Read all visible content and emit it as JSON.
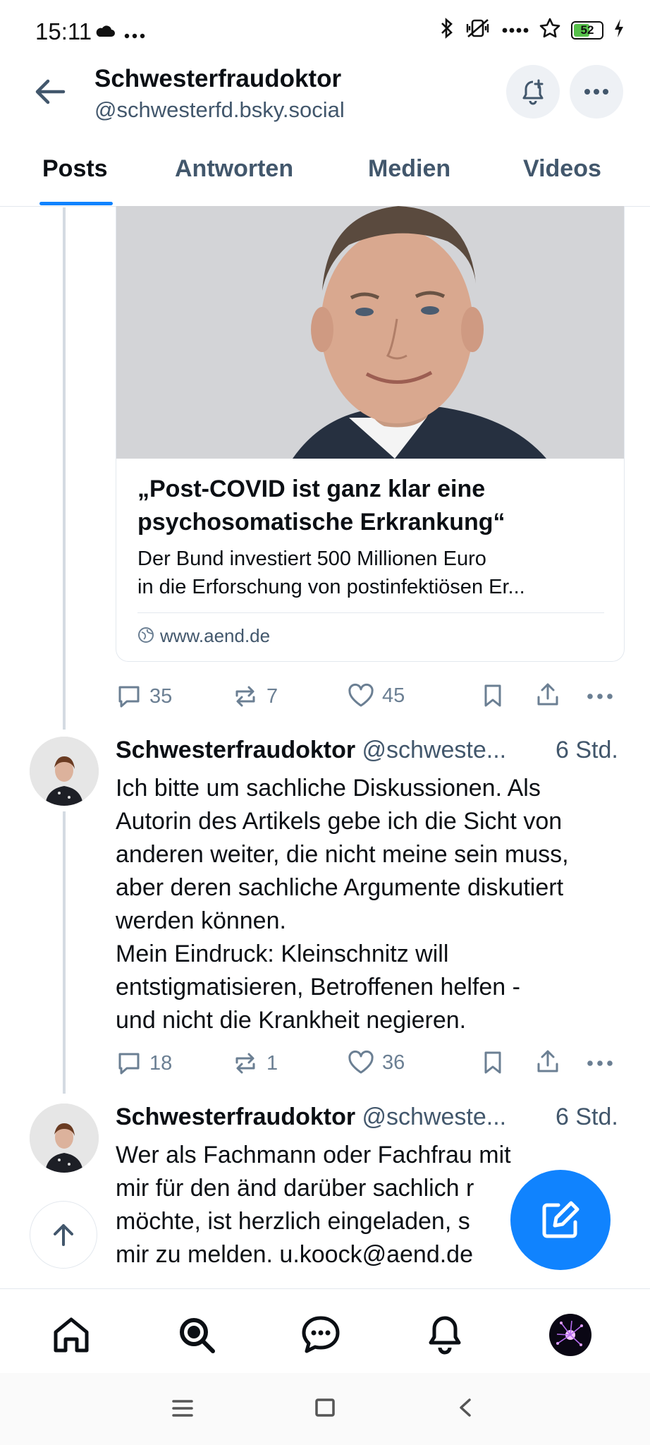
{
  "status_bar": {
    "time": "15:11",
    "battery": "52",
    "battery_level": 0.52
  },
  "header": {
    "display_name": "Schwesterfraudoktor",
    "handle": "@schwesterfd.bsky.social"
  },
  "tabs": [
    {
      "label": "Posts",
      "active": true
    },
    {
      "label": "Antworten",
      "active": false
    },
    {
      "label": "Medien",
      "active": false
    },
    {
      "label": "Videos",
      "active": false
    }
  ],
  "link_card": {
    "title": "„Post-COVID ist ganz klar eine psychosomatische Erkrankung“",
    "description_line1": "Der Bund investiert 500 Millionen Euro",
    "description_line2": "in die Erforschung von postinfektiösen Er...",
    "domain": "www.aend.de"
  },
  "first_post_actions": {
    "replies": "35",
    "reposts": "7",
    "likes": "45"
  },
  "posts": [
    {
      "author": "Schwesterfraudoktor",
      "handle": "@schweste...",
      "time": "6 Std.",
      "text": "Ich bitte um sachliche Diskussionen. Als\nAutorin des Artikels gebe ich die Sicht von\nanderen weiter, die nicht meine sein muss,\naber deren sachliche Argumente diskutiert\nwerden können.\nMein Eindruck: Kleinschnitz will\nentstigmatisieren, Betroffenen helfen -\nund nicht die Krankheit negieren.",
      "replies": "18",
      "reposts": "1",
      "likes": "36"
    },
    {
      "author": "Schwesterfraudoktor",
      "handle": "@schweste...",
      "time": "6 Std.",
      "text": "Wer als Fachmann oder Fachfrau mit\nmir für den änd darüber sachlich r\nmöchte, ist herzlich eingeladen, s\nmir zu melden. u.koock@aend.de"
    }
  ],
  "icons": {
    "back": "arrow-left-icon",
    "subscribe": "bell-plus-icon",
    "more": "ellipsis-icon",
    "reply": "speech-bubble-icon",
    "repost": "repost-icon",
    "like": "heart-icon",
    "bookmark": "bookmark-icon",
    "share": "share-icon",
    "compose": "pencil-square-icon",
    "scroll_top": "arrow-up-icon"
  },
  "colors": {
    "accent": "#1083fe",
    "muted": "#42576c",
    "action": "#6b7f93"
  }
}
